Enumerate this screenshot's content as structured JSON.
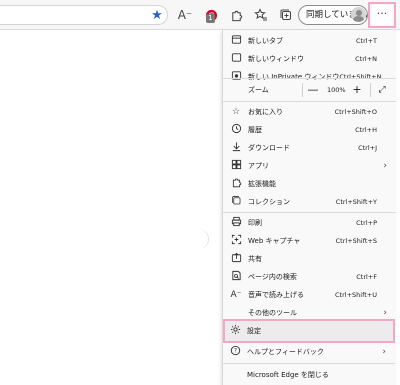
{
  "toolbar": {
    "profile_label": "同期していません",
    "more_label": "···",
    "extension_badge": "1"
  },
  "zoom": {
    "label": "ズーム",
    "minus": "—",
    "value": "100%",
    "plus": "+"
  },
  "menu": {
    "items": [
      {
        "label": "新しいタブ",
        "shortcut": "Ctrl+T"
      },
      {
        "label": "新しいウィンドウ",
        "shortcut": "Ctrl+N"
      },
      {
        "label": "新しい InPrivate ウィンドウ",
        "shortcut": "Ctrl+Shift+N"
      },
      {
        "label": "お気に入り",
        "shortcut": "Ctrl+Shift+O"
      },
      {
        "label": "履歴",
        "shortcut": "Ctrl+H"
      },
      {
        "label": "ダウンロード",
        "shortcut": "Ctrl+J"
      },
      {
        "label": "アプリ",
        "shortcut": ""
      },
      {
        "label": "拡張機能",
        "shortcut": ""
      },
      {
        "label": "コレクション",
        "shortcut": "Ctrl+Shift+Y"
      },
      {
        "label": "印刷",
        "shortcut": "Ctrl+P"
      },
      {
        "label": "Web キャプチャ",
        "shortcut": "Ctrl+Shift+S"
      },
      {
        "label": "共有",
        "shortcut": ""
      },
      {
        "label": "ページ内の検索",
        "shortcut": "Ctrl+F"
      },
      {
        "label": "音声で読み上げる",
        "shortcut": "Ctrl+Shift+U"
      },
      {
        "label": "その他のツール",
        "shortcut": ""
      },
      {
        "label": "設定",
        "shortcut": ""
      },
      {
        "label": "ヘルプとフィードバック",
        "shortcut": ""
      },
      {
        "label": "Microsoft Edge を閉じる",
        "shortcut": ""
      }
    ]
  },
  "colors": {
    "highlight": "#f0a8c7",
    "accent": "#2a62c9"
  }
}
